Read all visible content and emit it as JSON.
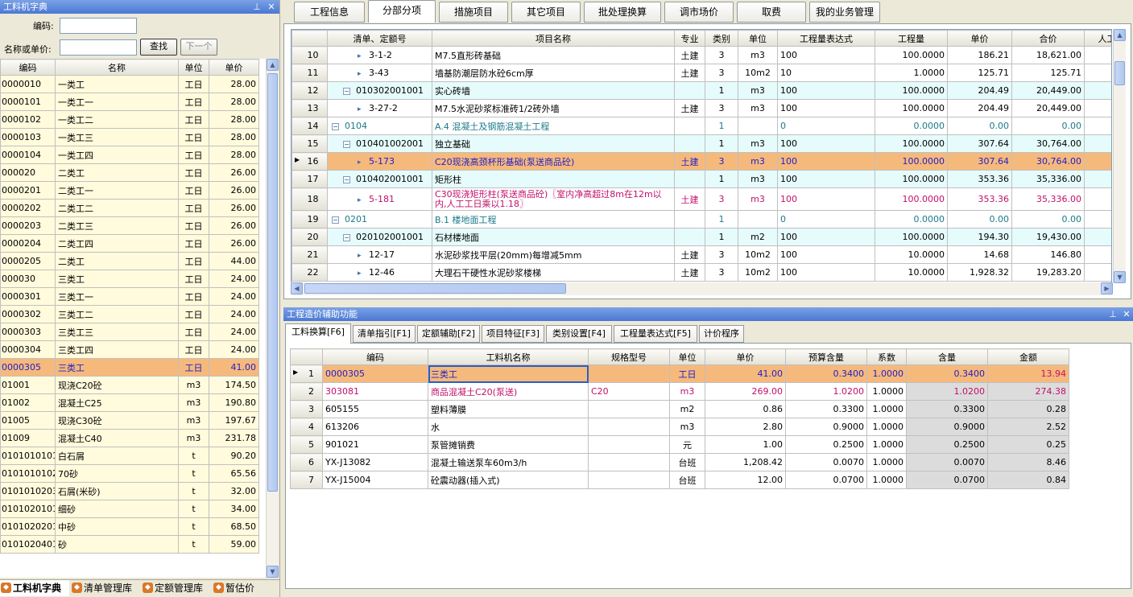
{
  "left_panel": {
    "title": "工料机字典",
    "code_label": "编码:",
    "name_label": "名称或单价:",
    "code_value": "",
    "name_value": "",
    "search_btn": "查找",
    "next_btn": "下一个",
    "columns": [
      "编码",
      "名称",
      "单位",
      "单价"
    ],
    "rows": [
      [
        "0000010",
        "一类工",
        "工日",
        "28.00"
      ],
      [
        "0000101",
        "一类工一",
        "工日",
        "28.00"
      ],
      [
        "0000102",
        "一类工二",
        "工日",
        "28.00"
      ],
      [
        "0000103",
        "一类工三",
        "工日",
        "28.00"
      ],
      [
        "0000104",
        "一类工四",
        "工日",
        "28.00"
      ],
      [
        "000020",
        "二类工",
        "工日",
        "26.00"
      ],
      [
        "0000201",
        "二类工一",
        "工日",
        "26.00"
      ],
      [
        "0000202",
        "二类工二",
        "工日",
        "26.00"
      ],
      [
        "0000203",
        "二类工三",
        "工日",
        "26.00"
      ],
      [
        "0000204",
        "二类工四",
        "工日",
        "26.00"
      ],
      [
        "0000205",
        "二类工",
        "工日",
        "44.00"
      ],
      [
        "000030",
        "三类工",
        "工日",
        "24.00"
      ],
      [
        "0000301",
        "三类工一",
        "工日",
        "24.00"
      ],
      [
        "0000302",
        "三类工二",
        "工日",
        "24.00"
      ],
      [
        "0000303",
        "三类工三",
        "工日",
        "24.00"
      ],
      [
        "0000304",
        "三类工四",
        "工日",
        "24.00"
      ],
      [
        "0000305",
        "三类工",
        "工日",
        "41.00"
      ],
      [
        "01001",
        "现浇C20砼",
        "m3",
        "174.50"
      ],
      [
        "01002",
        "混凝土C25",
        "m3",
        "190.80"
      ],
      [
        "01005",
        "现浇C30砼",
        "m3",
        "197.67"
      ],
      [
        "01009",
        "混凝土C40",
        "m3",
        "231.78"
      ],
      [
        "0101010101",
        "白石屑",
        "t",
        "90.20"
      ],
      [
        "0101010102",
        "70砂",
        "t",
        "65.56"
      ],
      [
        "0101010203",
        "石屑(米砂)",
        "t",
        "32.00"
      ],
      [
        "0101020101",
        "细砂",
        "t",
        "34.00"
      ],
      [
        "0101020201",
        "中砂",
        "t",
        "68.50"
      ],
      [
        "0101020401",
        "砂",
        "t",
        "59.00"
      ]
    ],
    "selected_row": 16,
    "bottom_tabs": [
      "工料机字典",
      "清单管理库",
      "定额管理库",
      "暂估价"
    ]
  },
  "main_tabs": [
    "工程信息",
    "分部分项",
    "措施项目",
    "其它项目",
    "批处理换算",
    "调市场价",
    "取费",
    "我的业务管理"
  ],
  "main_tab_active": 1,
  "grid": {
    "columns": [
      "清单、定额号",
      "项目名称",
      "专业",
      "类别",
      "单位",
      "工程量表达式",
      "工程量",
      "单价",
      "合价",
      "人工"
    ],
    "rows": [
      {
        "n": "10",
        "lvl": "item",
        "code": "3-1-2",
        "name": "M7.5直形砖基础",
        "spec": "土建",
        "cat": "3",
        "unit": "m3",
        "expr": "100",
        "qty": "100.0000",
        "price": "186.21",
        "total": "18,621.00"
      },
      {
        "n": "11",
        "lvl": "item",
        "code": "3-43",
        "name": "墙基防潮层防水砼6cm厚",
        "spec": "土建",
        "cat": "3",
        "unit": "10m2",
        "expr": "10",
        "qty": "1.0000",
        "price": "125.71",
        "total": "125.71"
      },
      {
        "n": "12",
        "lvl": "bill",
        "code": "010302001001",
        "name": "实心砖墙",
        "spec": "",
        "cat": "1",
        "unit": "m3",
        "expr": "100",
        "qty": "100.0000",
        "price": "204.49",
        "total": "20,449.00"
      },
      {
        "n": "13",
        "lvl": "item",
        "code": "3-27-2",
        "name": "M7.5水泥砂浆标准砖1/2砖外墙",
        "spec": "土建",
        "cat": "3",
        "unit": "m3",
        "expr": "100",
        "qty": "100.0000",
        "price": "204.49",
        "total": "20,449.00"
      },
      {
        "n": "14",
        "lvl": "section",
        "code": "0104",
        "name": "A.4 混凝土及钢筋混凝土工程",
        "spec": "",
        "cat": "1",
        "unit": "",
        "expr": "0",
        "qty": "0.0000",
        "price": "0.00",
        "total": "0.00"
      },
      {
        "n": "15",
        "lvl": "bill",
        "code": "010401002001",
        "name": "独立基础",
        "spec": "",
        "cat": "1",
        "unit": "m3",
        "expr": "100",
        "qty": "100.0000",
        "price": "307.64",
        "total": "30,764.00"
      },
      {
        "n": "16",
        "lvl": "item-sel",
        "code": "5-173",
        "name": "C20现浇高颈杯形基础(泵送商品砼)",
        "spec": "土建",
        "cat": "3",
        "unit": "m3",
        "expr": "100",
        "qty": "100.0000",
        "price": "307.64",
        "total": "30,764.00"
      },
      {
        "n": "17",
        "lvl": "bill",
        "code": "010402001001",
        "name": "矩形柱",
        "spec": "",
        "cat": "1",
        "unit": "m3",
        "expr": "100",
        "qty": "100.0000",
        "price": "353.36",
        "total": "35,336.00"
      },
      {
        "n": "18",
        "lvl": "item-pink",
        "code": "5-181",
        "name": "C30现浇矩形柱(泵送商品砼)〖室内净高超过8m在12m以内,人工工日乘以1.18〗",
        "spec": "土建",
        "cat": "3",
        "unit": "m3",
        "expr": "100",
        "qty": "100.0000",
        "price": "353.36",
        "total": "35,336.00"
      },
      {
        "n": "19",
        "lvl": "section",
        "code": "0201",
        "name": "B.1 楼地面工程",
        "spec": "",
        "cat": "1",
        "unit": "",
        "expr": "0",
        "qty": "0.0000",
        "price": "0.00",
        "total": "0.00"
      },
      {
        "n": "20",
        "lvl": "bill",
        "code": "020102001001",
        "name": "石材楼地面",
        "spec": "",
        "cat": "1",
        "unit": "m2",
        "expr": "100",
        "qty": "100.0000",
        "price": "194.30",
        "total": "19,430.00"
      },
      {
        "n": "21",
        "lvl": "item",
        "code": "12-17",
        "name": "水泥砂浆找平层(20mm)每增减5mm",
        "spec": "土建",
        "cat": "3",
        "unit": "10m2",
        "expr": "100",
        "qty": "10.0000",
        "price": "14.68",
        "total": "146.80"
      },
      {
        "n": "22",
        "lvl": "item",
        "code": "12-46",
        "name": "大理石干硬性水泥砂浆楼梯",
        "spec": "土建",
        "cat": "3",
        "unit": "10m2",
        "expr": "100",
        "qty": "10.0000",
        "price": "1,928.32",
        "total": "19,283.20"
      }
    ]
  },
  "aux": {
    "title": "工程造价辅助功能",
    "tabs": [
      "工料换算[F6]",
      "清单指引[F1]",
      "定额辅助[F2]",
      "项目特征[F3]",
      "类别设置[F4]",
      "工程量表达式[F5]",
      "计价程序"
    ],
    "tab_active": 0,
    "columns": [
      "编码",
      "工料机名称",
      "规格型号",
      "单位",
      "单价",
      "预算含量",
      "系数",
      "含量",
      "金额"
    ],
    "rows": [
      [
        "1",
        "0000305",
        "三类工",
        "",
        "工日",
        "41.00",
        "0.3400",
        "1.0000",
        "0.3400",
        "13.94"
      ],
      [
        "2",
        "303081",
        "商品混凝土C20(泵送)",
        "C20",
        "m3",
        "269.00",
        "1.0200",
        "1.0000",
        "1.0200",
        "274.38"
      ],
      [
        "3",
        "605155",
        "塑料薄膜",
        "",
        "m2",
        "0.86",
        "0.3300",
        "1.0000",
        "0.3300",
        "0.28"
      ],
      [
        "4",
        "613206",
        "水",
        "",
        "m3",
        "2.80",
        "0.9000",
        "1.0000",
        "0.9000",
        "2.52"
      ],
      [
        "5",
        "901021",
        "泵管摊销费",
        "",
        "元",
        "1.00",
        "0.2500",
        "1.0000",
        "0.2500",
        "0.25"
      ],
      [
        "6",
        "YX-J13082",
        "混凝土输送泵车60m3/h",
        "",
        "台班",
        "1,208.42",
        "0.0070",
        "1.0000",
        "0.0070",
        "8.46"
      ],
      [
        "7",
        "YX-J15004",
        "砼震动器(插入式)",
        "",
        "台班",
        "12.00",
        "0.0700",
        "1.0000",
        "0.0700",
        "0.84"
      ]
    ]
  },
  "colors": {
    "selected": "#f6b97c",
    "bill": "#e6fbfb",
    "cream": "#fffbdc",
    "section_text": "#1a7a8a",
    "pink": "#c0106a",
    "blue": "#2020c8"
  }
}
